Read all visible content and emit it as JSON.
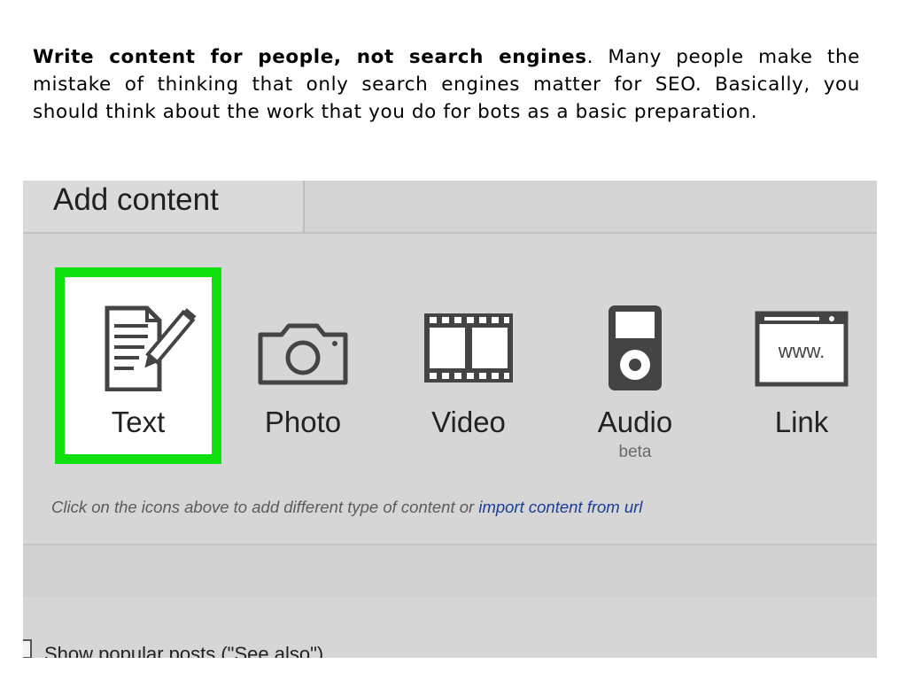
{
  "intro": {
    "bold": "Write content for people, not search engines",
    "rest": ". Many people make the mistake of thinking that only search engines matter for SEO. Basically, you should think about the work that you do for bots as a basic preparation."
  },
  "editor": {
    "tab_title": "Add content",
    "types": [
      {
        "label": "Text",
        "icon": "document-pencil-icon",
        "selected": true
      },
      {
        "label": "Photo",
        "icon": "camera-icon"
      },
      {
        "label": "Video",
        "icon": "film-strip-icon"
      },
      {
        "label": "Audio",
        "icon": "media-player-icon",
        "sublabel": "beta"
      },
      {
        "label": "Link",
        "icon": "browser-window-icon",
        "icon_text": "www."
      }
    ],
    "hint_text": "Click on the icons above to add different type of content or ",
    "hint_link": "import content from url",
    "popular_label": "Show popular posts (\"See also\")",
    "highlight_color": "#10e010",
    "link_color": "#1a3e96"
  }
}
